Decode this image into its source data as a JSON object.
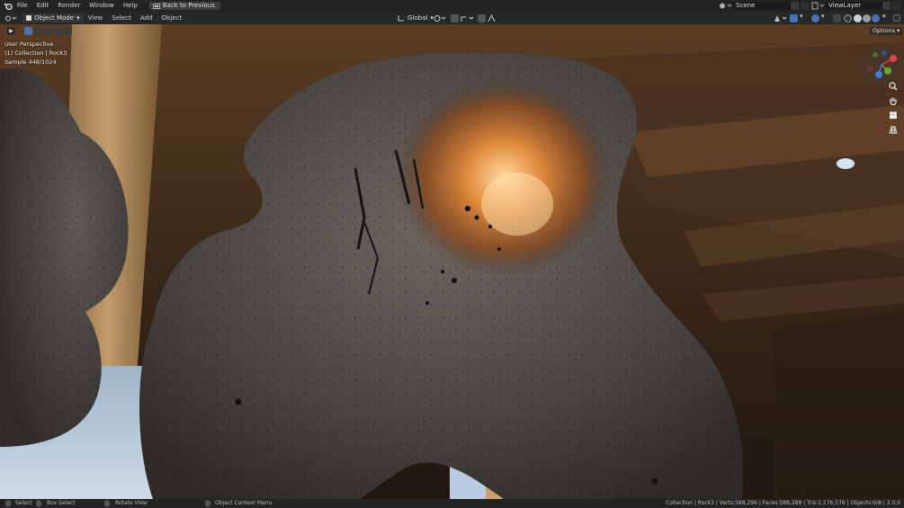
{
  "topbar": {
    "menus": [
      "File",
      "Edit",
      "Render",
      "Window",
      "Help"
    ],
    "back_label": "Back to Previous",
    "scene_value": "Scene",
    "view_layer_value": "ViewLayer"
  },
  "header": {
    "mode_label": "Object Mode",
    "menus": [
      "View",
      "Select",
      "Add",
      "Object"
    ],
    "orientation_label": "Global",
    "options_label": "Options"
  },
  "viewport": {
    "perspective": "User Perspective",
    "collection": "(1) Collection | Rock3",
    "samples": "Sample 448/1024"
  },
  "statusbar": {
    "select": "Select",
    "box_select": "Box Select",
    "rotate_view": "Rotate View",
    "context_menu": "Object Context Menu",
    "stats": "Collection | Rock3 | Verts:588,296 | Faces:588,288 | Tris:1,176,576 | Objects:0/8 | 3.0.0"
  },
  "colors": {
    "accent": "#4772b3",
    "x_axis": "#e0454e",
    "y_axis": "#6ba339",
    "z_axis": "#3d7ede"
  },
  "icons": [
    "blender-logo-icon",
    "back-icon",
    "scene-icon",
    "viewlayer-icon",
    "orientation-icon",
    "pivot-icon",
    "snap-icon",
    "proportional-icon",
    "zoom-icon",
    "hand-icon",
    "camera-icon",
    "grid-icon"
  ]
}
